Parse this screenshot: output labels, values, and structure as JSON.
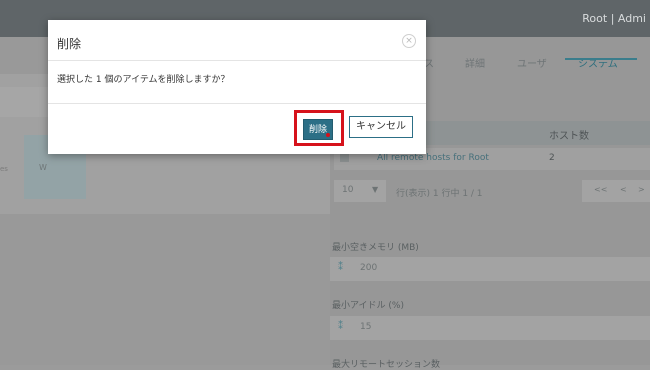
{
  "header": {
    "user_text": "Root | Admi"
  },
  "left": {
    "faint_a": "es",
    "faint_b": "W"
  },
  "tabs": [
    {
      "label": "ス",
      "active": false
    },
    {
      "label": "詳細",
      "active": false
    },
    {
      "label": "ユーザ",
      "active": false
    },
    {
      "label": "システム",
      "active": true
    }
  ],
  "table": {
    "col_host_count": "ホスト数",
    "rows": [
      {
        "name": "All remote hosts for Root",
        "count": "2"
      }
    ]
  },
  "pager": {
    "page_size": "10",
    "info": "行(表示)  1 行中 1 / 1",
    "first": "<<",
    "prev": "<",
    "next": ">"
  },
  "fields": {
    "min_free_memory_label": "最小空きメモリ (MB)",
    "min_free_memory_value": "200",
    "min_idle_label": "最小アイドル (%)",
    "min_idle_value": "15",
    "max_remote_label": "最大リモートセッション数"
  },
  "dialog": {
    "title": "削除",
    "message": "選択した 1 個のアイテムを削除しますか？",
    "confirm_label": "削除",
    "cancel_label": "キャンセル",
    "close_icon": "×"
  },
  "colors": {
    "accent": "#2c6f86",
    "highlight": "#d6121b"
  }
}
